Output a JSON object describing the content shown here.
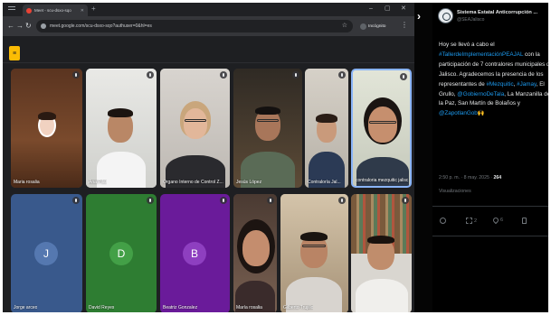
{
  "browser": {
    "tab_title": "Meet - scu-dsxo-sqo",
    "url": "meet.google.com/scu-dsxo-sqo?authuser=0&hl=es",
    "incognito_label": "Incógnito"
  },
  "meet": {
    "participants": [
      {
        "name": "Maria rosalia"
      },
      {
        "name": "Ana Pilar"
      },
      {
        "name": "Órgano Interno de Control Z..."
      },
      {
        "name": "Jesús López"
      },
      {
        "name": "Contraloría Jal..."
      },
      {
        "name": "contraloria mezquitic jalisco"
      },
      {
        "name": "Jorge arceo",
        "initial": "J",
        "color": "#3c5a8a"
      },
      {
        "name": "David Reyes",
        "initial": "D",
        "color": "#2e7d32"
      },
      {
        "name": "Beatriz Gonzalez",
        "initial": "B",
        "color": "#6a1b9a"
      },
      {
        "name": "María rosalia"
      },
      {
        "name": "Gilberto Trujillo"
      },
      {
        "name": ""
      }
    ]
  },
  "tweet": {
    "account_name": "Sistema Estatal Anticorrupción ...",
    "handle": "@SEAJalisco",
    "body": {
      "p1": "Hoy se llevó a cabo el ",
      "tag1": "#TallerdeImplementaciónPEAJAL",
      "p2": " con la participación de 7 contralores municipales de Jalisco. Agradecemos la presencia de los representantes de ",
      "tag2": "#Mezquitic",
      "p3": ", ",
      "tag3": "#Jamay",
      "p4": ", El Grullo, ",
      "tag4": "@GobiernoDeTala",
      "p5": ", La Manzanilla de la Paz, San Martín de Bolaños y ",
      "tag5": "@ZapotlanGob",
      "emoji": "🙌"
    },
    "timestamp": "2:50 p. m. · 8 may. 2025 · ",
    "views_count": "264",
    "views_label": "Visualizaciones",
    "actions": {
      "replies": "",
      "reposts": "2",
      "likes": "6"
    },
    "colors": {
      "link": "#1d9bf0",
      "text": "#e7e9ea",
      "muted": "#71767b"
    }
  }
}
